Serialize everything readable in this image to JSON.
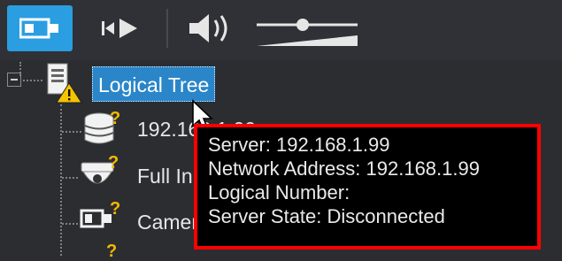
{
  "toolbar": {
    "buttons": [
      {
        "id": "camera",
        "icon": "camera-icon",
        "active": true
      },
      {
        "id": "play",
        "icon": "play-from-start-icon",
        "active": false
      },
      {
        "id": "volume",
        "icon": "speaker-icon",
        "active": false
      }
    ],
    "volume_level": 0.45,
    "accent_color": "#2a9ee0"
  },
  "tree": {
    "root": {
      "label": "Logical Tree",
      "icon": "server-warning-icon",
      "expanded": true,
      "selected": true
    },
    "children": [
      {
        "label": "192.168.1.99",
        "icon": "database-warning-icon"
      },
      {
        "label": "Full In",
        "icon": "dome-camera-warning-icon"
      },
      {
        "label": "Camer",
        "icon": "camera-warning-icon"
      }
    ]
  },
  "tooltip": {
    "lines": [
      "Server:  192.168.1.99",
      "Network  Address:  192.168.1.99",
      "Logical  Number:",
      "Server State: Disconnected"
    ],
    "highlight_color": "#ff0000"
  }
}
